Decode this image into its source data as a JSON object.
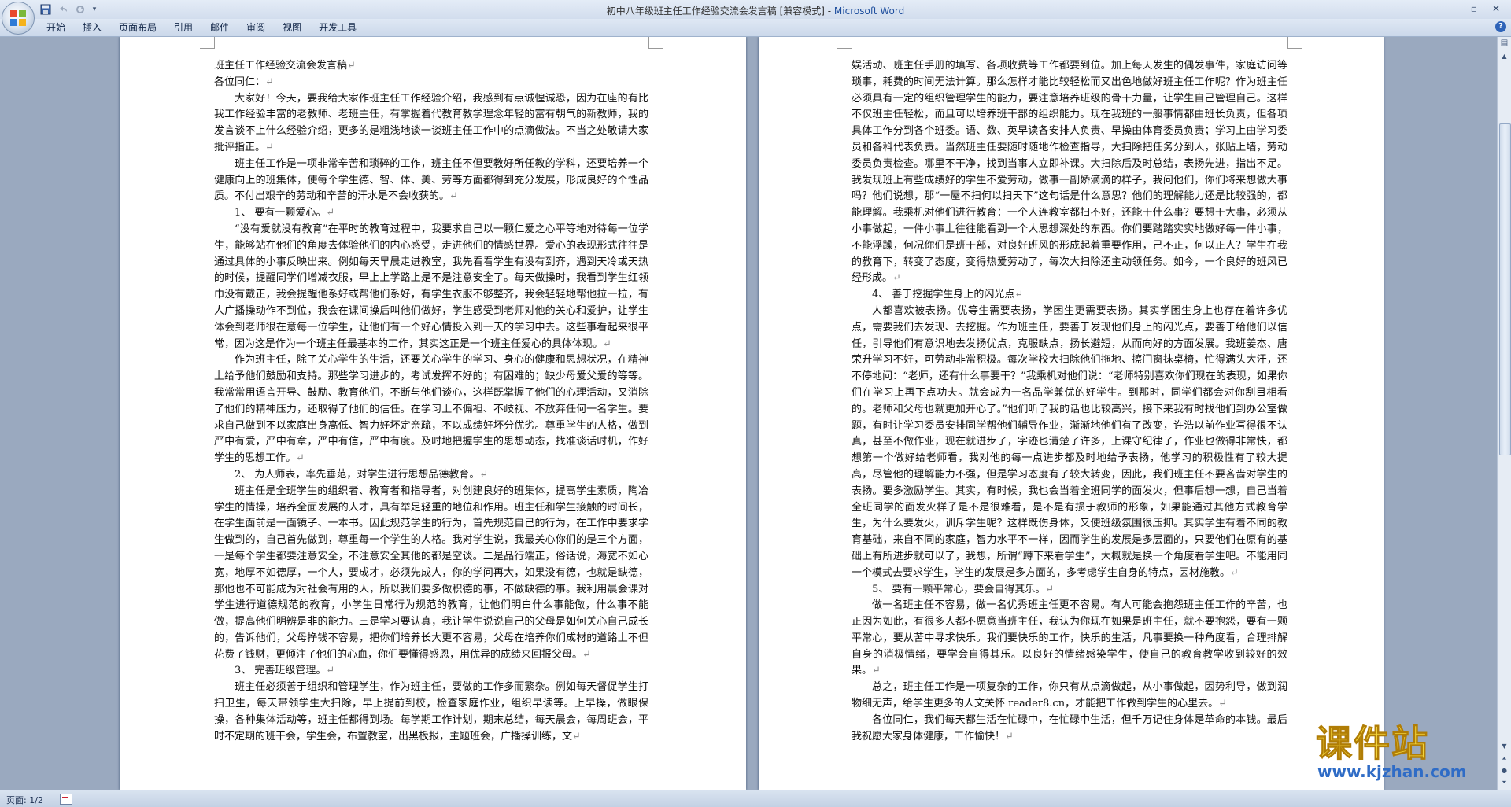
{
  "window": {
    "title_doc": "初中八年级班主任工作经验交流会发言稿 [兼容模式] - ",
    "title_app": "Microsoft Word",
    "controls": [
      "–",
      "▫",
      "✕"
    ]
  },
  "qat": {
    "icons": [
      "save-icon",
      "undo-icon",
      "redo-icon",
      "customize-icon"
    ]
  },
  "ribbon": {
    "tabs": [
      "开始",
      "插入",
      "页面布局",
      "引用",
      "邮件",
      "审阅",
      "视图",
      "开发工具"
    ],
    "help": "?"
  },
  "page1": {
    "paragraphs": [
      {
        "t": "班主任工作经验交流会发言稿",
        "ind": false
      },
      {
        "t": "各位同仁：",
        "ind": false
      },
      {
        "t": "大家好！今天，要我给大家作班主任工作经验介绍，我感到有点诚惶诚恐，因为在座的有比我工作经验丰富的老教师、老班主任，有掌握着代教育教学理念年轻的富有朝气的新教师，我的发言谈不上什么经验介绍，更多的是粗浅地谈一谈班主任工作中的点滴做法。不当之处敬请大家批评指正。",
        "ind": true
      },
      {
        "t": "班主任工作是一项非常辛苦和琐碎的工作，班主任不但要教好所任教的学科，还要培养一个健康向上的班集体，使每个学生德、智、体、美、劳等方面都得到充分发展，形成良好的个性品质。不付出艰辛的劳动和辛苦的汗水是不会收获的。",
        "ind": true
      },
      {
        "t": "1、 要有一颗爱心。",
        "ind": true
      },
      {
        "t": "“没有爱就没有教育”在平时的教育过程中，我要求自己以一颗仁爱之心平等地对待每一位学生，能够站在他们的角度去体验他们的内心感受，走进他们的情感世界。爱心的表现形式往往是通过具体的小事反映出来。例如每天早晨走进教室，我先看看学生有没有到齐，遇到天冷或天热的时候，提醒同学们增减衣服，早上上学路上是不是注意安全了。每天做操时，我看到学生红领巾没有戴正，我会提醒他系好或帮他们系好，有学生衣服不够整齐，我会轻轻地帮他拉一拉，有人广播操动作不到位，我会在课间操后叫他们做好，学生感受到老师对他的关心和爱护，让学生体会到老师很在意每一位学生，让他们有一个好心情投入到一天的学习中去。这些事看起来很平常，因为这是作为一个班主任最基本的工作，其实这正是一个班主任爱心的具体体现。",
        "ind": true
      },
      {
        "t": "作为班主任，除了关心学生的生活，还要关心学生的学习、身心的健康和思想状况，在精神上给予他们鼓励和支持。那些学习进步的，考试发挥不好的；有困难的；缺少母爱父爱的等等。我常常用语言开导、鼓励、教育他们，不断与他们谈心，这样既掌握了他们的心理活动，又消除了他们的精神压力，还取得了他们的信任。在学习上不偏袒、不歧视、不放弃任何一名学生。要求自己做到不以家庭出身高低、智力好坏定亲疏，不以成绩好坏分优劣。尊重学生的人格，做到严中有爱，严中有章，严中有信，严中有度。及时地把握学生的思想动态，找准谈话时机，作好学生的思想工作。",
        "ind": true
      },
      {
        "t": "2、 为人师表，率先垂范，对学生进行思想品德教育。",
        "ind": true
      },
      {
        "t": "班主任是全班学生的组织者、教育者和指导者，对创建良好的班集体，提高学生素质，陶冶学生的情操，培养全面发展的人才，具有举足轻重的地位和作用。班主任和学生接触的时间长，在学生面前是一面镜子、一本书。因此规范学生的行为，首先规范自己的行为，在工作中要求学生做到的，自己首先做到，尊重每一个学生的人格。我对学生说，我最关心你们的是三个方面，一是每个学生都要注意安全，不注意安全其他的都是空谈。二是品行端正，俗话说，海宽不如心宽，地厚不如德厚，一个人，要成才，必须先成人，你的学问再大，如果没有德，也就是缺德，那他也不可能成为对社会有用的人，所以我们要多做积德的事，不做缺德的事。我利用晨会课对学生进行道德规范的教育，小学生日常行为规范的教育，让他们明白什么事能做，什么事不能做，提高他们明辨是非的能力。三是学习要认真，我让学生说说自己的父母是如何关心自己成长的，告诉他们，父母挣钱不容易，把你们培养长大更不容易，父母在培养你们成材的道路上不但花费了钱财，更倾注了他们的心血，你们要懂得感恩，用优异的成绩来回报父母。",
        "ind": true
      },
      {
        "t": "3、 完善班级管理。",
        "ind": true
      },
      {
        "t": "班主任必须善于组织和管理学生，作为班主任，要做的工作多而繁杂。例如每天督促学生打扫卫生，每天带领学生大扫除，早上提前到校，检查家庭作业，组织早读等。上早操，做眼保操，各种集体活动等，班主任都得到场。每学期工作计划，期末总结，每天晨会，每周班会，平时不定期的班干会，学生会，布置教室，出黑板报，主题班会，广播操训练，文",
        "ind": true
      }
    ]
  },
  "page2": {
    "paragraphs": [
      {
        "t": "娱活动、班主任手册的填写、各项收费等工作都要到位。加上每天发生的偶发事件，家庭访问等琐事，耗费的时间无法计算。那么怎样才能比较轻松而又出色地做好班主任工作呢？作为班主任必须具有一定的组织管理学生的能力，要注意培养班级的骨干力量，让学生自己管理自己。这样不仅班主任轻松，而且可以培养班干部的组织能力。现在我班的一般事情都由班长负责，但各项具体工作分到各个班委。语、数、英早读各安排人负责、早操由体育委员负责；学习上由学习委员和各科代表负责。当然班主任要随时随地作检查指导，大扫除把任务分到人，张贴上墙，劳动委员负责检查。哪里不干净，找到当事人立即补课。大扫除后及时总结，表扬先进，指出不足。我发现班上有些成绩好的学生不爱劳动，做事一副娇滴滴的样子，我问他们，你们将来想做大事吗？他们说想，那“一屋不扫何以扫天下”这句话是什么意思？他们的理解能力还是比较强的，都能理解。我乘机对他们进行教育：一个人连教室都扫不好，还能干什么事？要想干大事，必须从小事做起，一件小事上往往能看到一个人思想深处的东西。你们要踏踏实实地做好每一件小事，不能浮躁，何况你们是班干部，对良好班风的形成起着重要作用，己不正，何以正人？学生在我的教育下，转变了态度，变得热爱劳动了，每次大扫除还主动领任务。如今，一个良好的班风已经形成。",
        "ind": false
      },
      {
        "t": "4、 善于挖掘学生身上的闪光点",
        "ind": true
      },
      {
        "t": "人都喜欢被表扬。优等生需要表扬，学困生更需要表扬。其实学困生身上也存在着许多优点，需要我们去发现、去挖掘。作为班主任，要善于发现他们身上的闪光点，要善于给他们以信任，引导他们有意识地去发扬优点，克服缺点，扬长避短，从而向好的方面发展。我班姜杰、唐荣升学习不好，可劳动非常积极。每次学校大扫除他们拖地、擦门窗抹桌椅，忙得满头大汗，还不停地问：“老师，还有什么事要干？”我乘机对他们说：“老师特别喜欢你们现在的表现，如果你们在学习上再下点功夫。就会成为一名品学兼优的好学生。到那时，同学们都会对你刮目相看的。老师和父母也就更加开心了。”他们听了我的话也比较高兴，接下来我有时找他们到办公室做题，有时让学习委员安排同学帮他们辅导作业，渐渐地他们有了改变，许浩以前作业写得很不认真，甚至不做作业，现在就进步了，字迹也清楚了许多，上课守纪律了，作业也做得非常快，都想第一个做好给老师看，我对他的每一点进步都及时地给予表扬，他学习的积极性有了较大提高，尽管他的理解能力不强，但是学习态度有了较大转变，因此，我们班主任不要吝啬对学生的表扬。要多激励学生。其实，有时候，我也会当着全班同学的面发火，但事后想一想，自己当着全班同学的面发火样子是不是很难看，是不是有损于教师的形象，如果能通过其他方式教育学生，为什么要发火，训斥学生呢？这样既伤身体，又使班级氛围很压抑。其实学生有着不同的教育基础，来自不同的家庭，智力水平不一样，因而学生的发展是多层面的，只要他们在原有的基础上有所进步就可以了，我想，所谓“蹲下来看学生”，大概就是换一个角度看学生吧。不能用同一个模式去要求学生，学生的发展是多方面的，多考虑学生自身的特点，因材施教。",
        "ind": true
      },
      {
        "t": "5、 要有一颗平常心，要会自得其乐。",
        "ind": true
      },
      {
        "t": "做一名班主任不容易，做一名优秀班主任更不容易。有人可能会抱怨班主任工作的辛苦，也正因为如此，有很多人都不愿意当班主任，我认为你现在如果是班主任，就不要抱怨，要有一颗平常心，要从苦中寻求快乐。我们要快乐的工作，快乐的生活，凡事要换一种角度看，合理排解自身的消极情绪，要学会自得其乐。以良好的情绪感染学生，使自己的教育教学收到较好的效果。",
        "ind": true
      },
      {
        "t": "总之，班主任工作是一项复杂的工作，你只有从点滴做起，从小事做起，因势利导，做到润物细无声，给学生更多的人文关怀 reader8.cn，才能把工作做到学生的心里去。",
        "ind": true
      },
      {
        "t": "各位同仁，我们每天都生活在忙碌中，在忙碌中生活，但千万记住身体是革命的本钱。最后我祝愿大家身体健康，工作愉快！",
        "ind": true
      }
    ]
  },
  "status": {
    "page": "页面: 1/2"
  },
  "watermark": {
    "big": "课件站",
    "url": "www.kjzhan.com"
  },
  "colors": {
    "app_title": "#1f4f9e",
    "watermark_text": "#f2d43a",
    "watermark_url": "#2f6cc6"
  }
}
